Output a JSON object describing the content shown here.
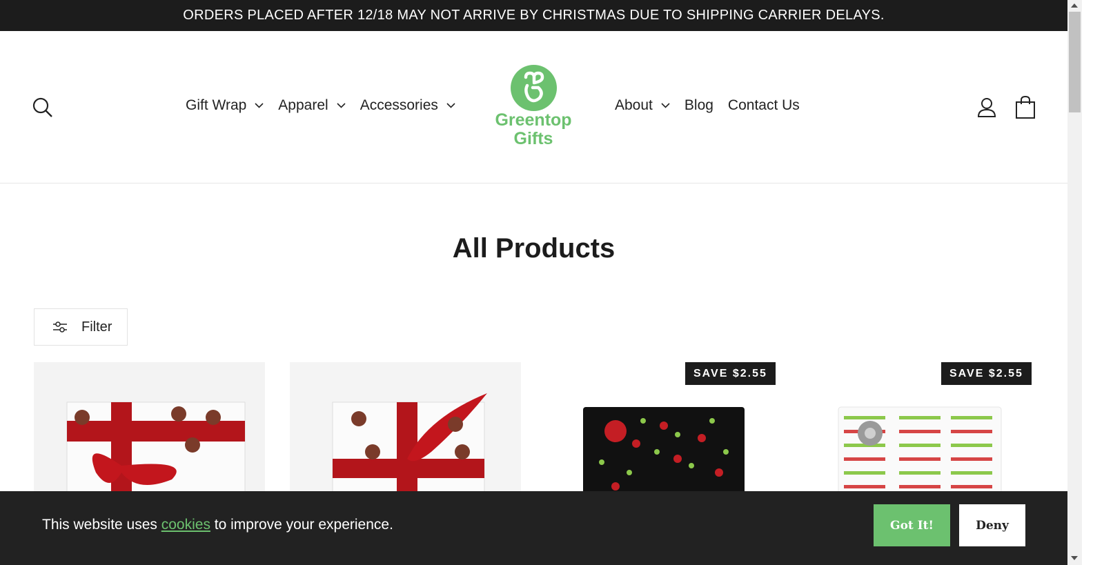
{
  "announcement": "ORDERS PLACED AFTER 12/18 MAY NOT ARRIVE BY CHRISTMAS DUE TO SHIPPING CARRIER DELAYS.",
  "nav_left": [
    {
      "label": "Gift Wrap",
      "has_dropdown": true
    },
    {
      "label": "Apparel",
      "has_dropdown": true
    },
    {
      "label": "Accessories",
      "has_dropdown": true
    }
  ],
  "nav_right": [
    {
      "label": "About",
      "has_dropdown": true
    },
    {
      "label": "Blog",
      "has_dropdown": false
    },
    {
      "label": "Contact Us",
      "has_dropdown": false
    }
  ],
  "logo": {
    "line1": "Greentop",
    "line2": "Gifts"
  },
  "icons": {
    "search": "search-icon",
    "account": "user-icon",
    "cart": "bag-icon",
    "filter": "sliders-icon"
  },
  "page_title": "All Products",
  "filter_label": "Filter",
  "badges": {
    "product3": "SAVE $2.55",
    "product4": "SAVE $2.55"
  },
  "cookie": {
    "before": "This website uses ",
    "link": "cookies",
    "after": " to improve your experience.",
    "accept": "Got It!",
    "deny": "Deny"
  },
  "colors": {
    "brand_green": "#6cc16f",
    "dark": "#1c1c1c"
  }
}
